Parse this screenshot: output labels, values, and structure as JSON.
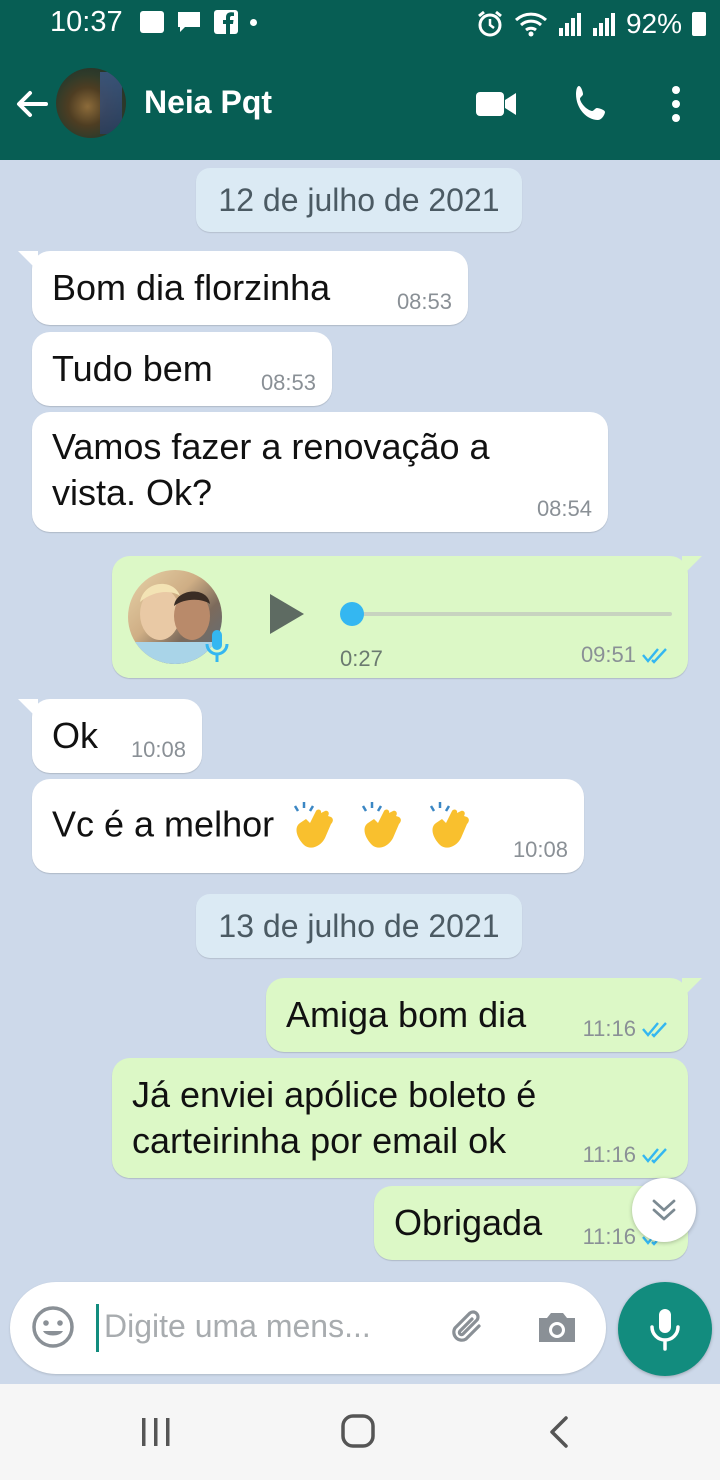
{
  "status_bar": {
    "time": "10:37",
    "battery": "92%",
    "left_icons": [
      "image-icon",
      "chat-icon",
      "facebook-icon",
      "dot-icon"
    ],
    "right_icons": [
      "alarm-icon",
      "wifi-icon",
      "signal-icon",
      "signal-icon",
      "battery-icon"
    ]
  },
  "header": {
    "contact_name": "Neia Pqt",
    "icons": [
      "back-arrow-icon",
      "video-call-icon",
      "phone-icon",
      "more-vert-icon"
    ]
  },
  "messages": [
    {
      "kind": "date",
      "text": "12 de julho de 2021"
    },
    {
      "kind": "in",
      "text": "Bom dia florzinha",
      "time": "08:53"
    },
    {
      "kind": "in",
      "text": "Tudo bem",
      "time": "08:53"
    },
    {
      "kind": "in",
      "text_line1": "Vamos fazer a renovação a",
      "text_line2": "vista. Ok?",
      "time": "08:54"
    },
    {
      "kind": "out-audio",
      "duration": "0:27",
      "time": "09:51",
      "progress": 0.0
    },
    {
      "kind": "in",
      "text": "Ok",
      "time": "10:08"
    },
    {
      "kind": "in",
      "text": "Vc é a melhor",
      "emoji": "👏👏👏",
      "time": "10:08"
    },
    {
      "kind": "date",
      "text": "13 de julho de 2021"
    },
    {
      "kind": "out",
      "text": "Amiga bom dia",
      "time": "11:16"
    },
    {
      "kind": "out",
      "text_line1": "Já enviei apólice boleto é",
      "text_line2": "carteirinha por email ok",
      "time": "11:16"
    },
    {
      "kind": "out",
      "text": "Obrigada",
      "time": "11:16"
    }
  ],
  "input": {
    "placeholder": "Digite uma mens..."
  },
  "colors": {
    "header": "#075e54",
    "chat_bg": "#cdd9ea",
    "outgoing": "#dcf8c6",
    "incoming": "#ffffff",
    "accent": "#128c7e",
    "read_ticks": "#34b7f1"
  }
}
